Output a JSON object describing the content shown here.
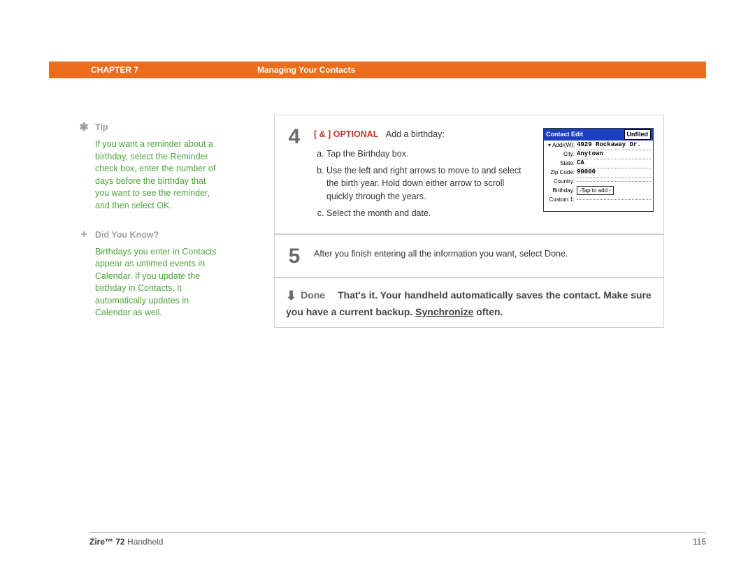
{
  "header": {
    "chapter": "CHAPTER 7",
    "title": "Managing Your Contacts"
  },
  "sidebar": {
    "tip": {
      "label": "Tip",
      "text": "If you want a reminder about a birthday, select the Reminder check box, enter the number of days before the birthday that you want to see the reminder, and then select OK."
    },
    "dyk": {
      "label": "Did You Know?",
      "text": "Birthdays you enter in Contacts appear as untimed events in Calendar. If you update the birthday in Contacts, it automatically updates in Calendar as well."
    }
  },
  "steps": {
    "four": {
      "number": "4",
      "optional_prefix": "[ & ]  OPTIONAL",
      "lead": "Add a birthday:",
      "items": {
        "a": "Tap the Birthday box.",
        "b": "Use the left and right arrows to move to and select the birth year. Hold down either arrow to scroll quickly through the years.",
        "c": "Select the month and date."
      }
    },
    "five": {
      "number": "5",
      "text": "After you finish entering all the information you want, select Done."
    }
  },
  "device": {
    "title": "Contact Edit",
    "category": "Unfiled",
    "fields": {
      "addr_label": "Addr(W):",
      "addr_value": "4929 Rockaway Dr.",
      "city_label": "City:",
      "city_value": "Anytown",
      "state_label": "State:",
      "state_value": "CA",
      "zip_label": "Zip Code:",
      "zip_value": "90000",
      "country_label": "Country:",
      "country_value": "",
      "birthday_label": "Birthday:",
      "birthday_value": "-Tap to add -",
      "custom1_label": "Custom 1:",
      "custom1_value": ""
    }
  },
  "done": {
    "label": "Done",
    "text_part1": "That's it. Your handheld automatically saves the contact. Make sure you have a current backup. ",
    "sync_link": "Synchronize",
    "text_part2": " often."
  },
  "footer": {
    "product_bold": "Zire™ 72",
    "product_rest": " Handheld",
    "page": "115"
  }
}
